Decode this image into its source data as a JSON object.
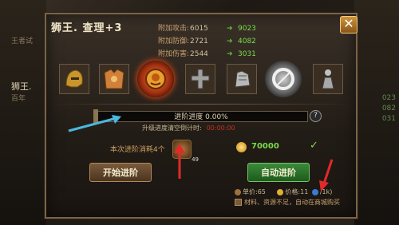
{
  "window": {
    "title": "狮王. 查理+3",
    "close_label": "✕"
  },
  "stats": [
    {
      "label": "附加攻击:",
      "value": "6015",
      "new_value": "9023"
    },
    {
      "label": "附加防御:",
      "value": "2721",
      "new_value": "4082"
    },
    {
      "label": "附加伤害:",
      "value": "2544",
      "new_value": "3031"
    }
  ],
  "progress": {
    "label": "进阶进度 0.00%",
    "percent": 0
  },
  "timer": {
    "label": "升级进度清空倒计时:",
    "value": "00:00:00"
  },
  "consume": {
    "label": "本次进阶消耗4个",
    "material_count": "49",
    "gold": "70000"
  },
  "buttons": {
    "start": "开始进阶",
    "auto": "自动进阶"
  },
  "price": {
    "single": "单价:65",
    "total": "价格:11",
    "qty": "/1k)"
  },
  "note": "材料、资源不足，自动在商城购买",
  "icons": [
    "helmet-icon",
    "armor-icon",
    "lion-emblem-icon",
    "cross-icon",
    "gauntlet-icon",
    "ring-icon",
    "figure-icon"
  ],
  "colors": {
    "accent": "#7adc4a",
    "frame": "#7a6446",
    "arrow": "#e02a2a",
    "arrow2": "#4ab8e0"
  },
  "background": {
    "left_labels": [
      "王者试",
      "狮王.",
      "百年"
    ],
    "right_labels": [
      "023",
      "082",
      "031"
    ]
  }
}
